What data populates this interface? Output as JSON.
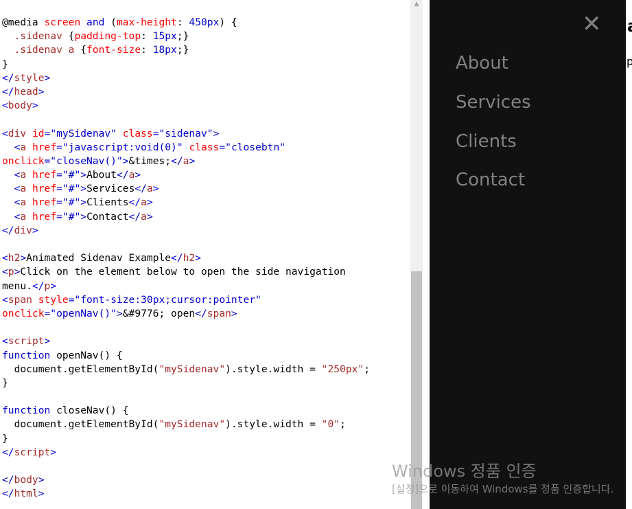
{
  "code_lines": [
    [
      {
        "c": "plain",
        "t": "@media "
      },
      {
        "c": "attr",
        "t": "screen"
      },
      {
        "c": "plain",
        "t": " "
      },
      {
        "c": "kw",
        "t": "and"
      },
      {
        "c": "plain",
        "t": " ("
      },
      {
        "c": "attr",
        "t": "max-height"
      },
      {
        "c": "plain",
        "t": ": "
      },
      {
        "c": "val",
        "t": "450px"
      },
      {
        "c": "plain",
        "t": ") {"
      }
    ],
    [
      {
        "c": "plain",
        "t": "  "
      },
      {
        "c": "tag",
        "t": ".sidenav"
      },
      {
        "c": "plain",
        "t": " {"
      },
      {
        "c": "attr",
        "t": "padding-top"
      },
      {
        "c": "plain",
        "t": ": "
      },
      {
        "c": "val",
        "t": "15px"
      },
      {
        "c": "plain",
        "t": ";}"
      }
    ],
    [
      {
        "c": "plain",
        "t": "  "
      },
      {
        "c": "tag",
        "t": ".sidenav a"
      },
      {
        "c": "plain",
        "t": " {"
      },
      {
        "c": "attr",
        "t": "font-size"
      },
      {
        "c": "plain",
        "t": ": "
      },
      {
        "c": "val",
        "t": "18px"
      },
      {
        "c": "plain",
        "t": ";}"
      }
    ],
    [
      {
        "c": "plain",
        "t": "}"
      }
    ],
    [
      {
        "c": "val",
        "t": "</"
      },
      {
        "c": "tag",
        "t": "style"
      },
      {
        "c": "val",
        "t": ">"
      }
    ],
    [
      {
        "c": "val",
        "t": "</"
      },
      {
        "c": "tag",
        "t": "head"
      },
      {
        "c": "val",
        "t": ">"
      }
    ],
    [
      {
        "c": "val",
        "t": "<"
      },
      {
        "c": "tag",
        "t": "body"
      },
      {
        "c": "val",
        "t": ">"
      }
    ],
    [],
    [
      {
        "c": "val",
        "t": "<"
      },
      {
        "c": "tag",
        "t": "div"
      },
      {
        "c": "plain",
        "t": " "
      },
      {
        "c": "attr",
        "t": "id"
      },
      {
        "c": "val",
        "t": "=\"mySidenav\""
      },
      {
        "c": "plain",
        "t": " "
      },
      {
        "c": "attr",
        "t": "class"
      },
      {
        "c": "val",
        "t": "=\"sidenav\""
      },
      {
        "c": "val",
        "t": ">"
      }
    ],
    [
      {
        "c": "plain",
        "t": "  "
      },
      {
        "c": "val",
        "t": "<"
      },
      {
        "c": "tag",
        "t": "a"
      },
      {
        "c": "plain",
        "t": " "
      },
      {
        "c": "attr",
        "t": "href"
      },
      {
        "c": "val",
        "t": "=\"javascript:void(0)\""
      },
      {
        "c": "plain",
        "t": " "
      },
      {
        "c": "attr",
        "t": "class"
      },
      {
        "c": "val",
        "t": "=\"closebtn\""
      }
    ],
    [
      {
        "c": "attr",
        "t": "onclick"
      },
      {
        "c": "val",
        "t": "=\"closeNav()\""
      },
      {
        "c": "val",
        "t": ">"
      },
      {
        "c": "plain",
        "t": "&times;"
      },
      {
        "c": "val",
        "t": "</"
      },
      {
        "c": "tag",
        "t": "a"
      },
      {
        "c": "val",
        "t": ">"
      }
    ],
    [
      {
        "c": "plain",
        "t": "  "
      },
      {
        "c": "val",
        "t": "<"
      },
      {
        "c": "tag",
        "t": "a"
      },
      {
        "c": "plain",
        "t": " "
      },
      {
        "c": "attr",
        "t": "href"
      },
      {
        "c": "val",
        "t": "=\"#\""
      },
      {
        "c": "val",
        "t": ">"
      },
      {
        "c": "plain",
        "t": "About"
      },
      {
        "c": "val",
        "t": "</"
      },
      {
        "c": "tag",
        "t": "a"
      },
      {
        "c": "val",
        "t": ">"
      }
    ],
    [
      {
        "c": "plain",
        "t": "  "
      },
      {
        "c": "val",
        "t": "<"
      },
      {
        "c": "tag",
        "t": "a"
      },
      {
        "c": "plain",
        "t": " "
      },
      {
        "c": "attr",
        "t": "href"
      },
      {
        "c": "val",
        "t": "=\"#\""
      },
      {
        "c": "val",
        "t": ">"
      },
      {
        "c": "plain",
        "t": "Services"
      },
      {
        "c": "val",
        "t": "</"
      },
      {
        "c": "tag",
        "t": "a"
      },
      {
        "c": "val",
        "t": ">"
      }
    ],
    [
      {
        "c": "plain",
        "t": "  "
      },
      {
        "c": "val",
        "t": "<"
      },
      {
        "c": "tag",
        "t": "a"
      },
      {
        "c": "plain",
        "t": " "
      },
      {
        "c": "attr",
        "t": "href"
      },
      {
        "c": "val",
        "t": "=\"#\""
      },
      {
        "c": "val",
        "t": ">"
      },
      {
        "c": "plain",
        "t": "Clients"
      },
      {
        "c": "val",
        "t": "</"
      },
      {
        "c": "tag",
        "t": "a"
      },
      {
        "c": "val",
        "t": ">"
      }
    ],
    [
      {
        "c": "plain",
        "t": "  "
      },
      {
        "c": "val",
        "t": "<"
      },
      {
        "c": "tag",
        "t": "a"
      },
      {
        "c": "plain",
        "t": " "
      },
      {
        "c": "attr",
        "t": "href"
      },
      {
        "c": "val",
        "t": "=\"#\""
      },
      {
        "c": "val",
        "t": ">"
      },
      {
        "c": "plain",
        "t": "Contact"
      },
      {
        "c": "val",
        "t": "</"
      },
      {
        "c": "tag",
        "t": "a"
      },
      {
        "c": "val",
        "t": ">"
      }
    ],
    [
      {
        "c": "val",
        "t": "</"
      },
      {
        "c": "tag",
        "t": "div"
      },
      {
        "c": "val",
        "t": ">"
      }
    ],
    [],
    [
      {
        "c": "val",
        "t": "<"
      },
      {
        "c": "tag",
        "t": "h2"
      },
      {
        "c": "val",
        "t": ">"
      },
      {
        "c": "plain",
        "t": "Animated Sidenav Example"
      },
      {
        "c": "val",
        "t": "</"
      },
      {
        "c": "tag",
        "t": "h2"
      },
      {
        "c": "val",
        "t": ">"
      }
    ],
    [
      {
        "c": "val",
        "t": "<"
      },
      {
        "c": "tag",
        "t": "p"
      },
      {
        "c": "val",
        "t": ">"
      },
      {
        "c": "plain",
        "t": "Click on the element below to open the side navigation"
      }
    ],
    [
      {
        "c": "plain",
        "t": "menu."
      },
      {
        "c": "val",
        "t": "</"
      },
      {
        "c": "tag",
        "t": "p"
      },
      {
        "c": "val",
        "t": ">"
      }
    ],
    [
      {
        "c": "val",
        "t": "<"
      },
      {
        "c": "tag",
        "t": "span"
      },
      {
        "c": "plain",
        "t": " "
      },
      {
        "c": "attr",
        "t": "style"
      },
      {
        "c": "val",
        "t": "=\"font-size:30px;cursor:pointer\""
      }
    ],
    [
      {
        "c": "attr",
        "t": "onclick"
      },
      {
        "c": "val",
        "t": "=\"openNav()\""
      },
      {
        "c": "val",
        "t": ">"
      },
      {
        "c": "plain",
        "t": "&#9776; open"
      },
      {
        "c": "val",
        "t": "</"
      },
      {
        "c": "tag",
        "t": "span"
      },
      {
        "c": "val",
        "t": ">"
      }
    ],
    [],
    [
      {
        "c": "val",
        "t": "<"
      },
      {
        "c": "tag",
        "t": "script"
      },
      {
        "c": "val",
        "t": ">"
      }
    ],
    [
      {
        "c": "kw",
        "t": "function"
      },
      {
        "c": "plain",
        "t": " openNav() {"
      }
    ],
    [
      {
        "c": "plain",
        "t": "  document.getElementById("
      },
      {
        "c": "str",
        "t": "\"mySidenav\""
      },
      {
        "c": "plain",
        "t": ").style.width = "
      },
      {
        "c": "str",
        "t": "\"250px\""
      },
      {
        "c": "plain",
        "t": ";"
      }
    ],
    [
      {
        "c": "plain",
        "t": "}"
      }
    ],
    [],
    [
      {
        "c": "kw",
        "t": "function"
      },
      {
        "c": "plain",
        "t": " closeNav() {"
      }
    ],
    [
      {
        "c": "plain",
        "t": "  document.getElementById("
      },
      {
        "c": "str",
        "t": "\"mySidenav\""
      },
      {
        "c": "plain",
        "t": ").style.width = "
      },
      {
        "c": "str",
        "t": "\"0\""
      },
      {
        "c": "plain",
        "t": ";"
      }
    ],
    [
      {
        "c": "plain",
        "t": "}"
      }
    ],
    [
      {
        "c": "val",
        "t": "</"
      },
      {
        "c": "tag",
        "t": "script"
      },
      {
        "c": "val",
        "t": ">"
      }
    ],
    [],
    [
      {
        "c": "val",
        "t": "</"
      },
      {
        "c": "tag",
        "t": "body"
      },
      {
        "c": "val",
        "t": ">"
      }
    ],
    [
      {
        "c": "val",
        "t": "</"
      },
      {
        "c": "tag",
        "t": "html"
      },
      {
        "c": "val",
        "t": ">"
      }
    ]
  ],
  "scrollbar": {
    "up_arrow": "▲"
  },
  "result": {
    "close_symbol": "✕",
    "nav_links": [
      "About",
      "Services",
      "Clients",
      "Contact"
    ],
    "behind_heading": "a",
    "behind_para": "p"
  },
  "watermark": {
    "title": "Windows 정품 인증",
    "subtitle": "[설정]으로 이동하여 Windows를 정품 인증합니다."
  },
  "colors": {
    "sidenav_bg": "#111111",
    "nav_link": "#818181",
    "code_tag": "#a52a2a",
    "code_attr": "#ff0000",
    "code_value": "#0000cd"
  }
}
